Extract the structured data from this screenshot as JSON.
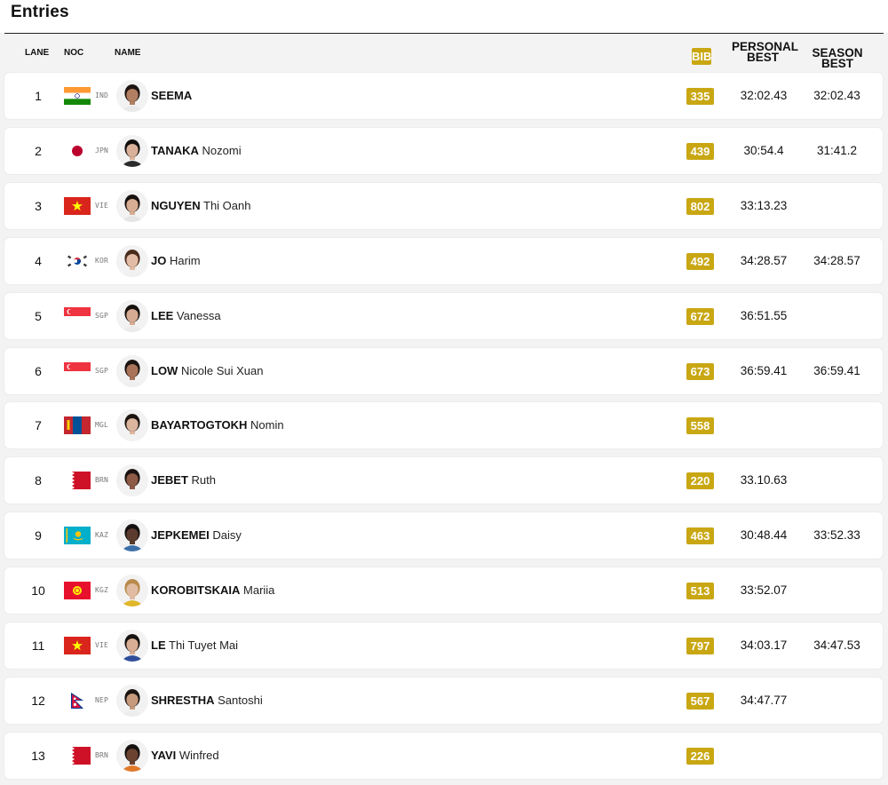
{
  "page": {
    "title": "Entries"
  },
  "columns": {
    "lane": "LANE",
    "noc": "NOC",
    "name": "NAME",
    "bib": "BIB",
    "personal_best": "PERSONAL BEST",
    "season_best": "SEASON BEST"
  },
  "theme": {
    "bib_color": "#c9a713"
  },
  "entries": [
    {
      "lane": "1",
      "noc": "IND",
      "flag": "ind-flag-icon",
      "last_name": "SEEMA",
      "first_name": "",
      "bib": "335",
      "pb": "32:02.43",
      "sb": "32:02.43",
      "skin": "#b27f62",
      "hair": "#1d1410",
      "shirt": "#e9e9e9"
    },
    {
      "lane": "2",
      "noc": "JPN",
      "flag": "jpn-flag-icon",
      "last_name": "TANAKA",
      "first_name": "Nozomi",
      "bib": "439",
      "pb": "30:54.4",
      "sb": "31:41.2",
      "skin": "#d9b19a",
      "hair": "#120e0c",
      "shirt": "#2b2b2b"
    },
    {
      "lane": "3",
      "noc": "VIE",
      "flag": "vie-flag-icon",
      "last_name": "NGUYEN",
      "first_name": "Thi Oanh",
      "bib": "802",
      "pb": "33:13.23",
      "sb": "",
      "skin": "#d7ad93",
      "hair": "#17110e",
      "shirt": "#e5e5e5"
    },
    {
      "lane": "4",
      "noc": "KOR",
      "flag": "kor-flag-icon",
      "last_name": "JO",
      "first_name": "Harim",
      "bib": "492",
      "pb": "34:28.57",
      "sb": "34:28.57",
      "skin": "#e2bca6",
      "hair": "#4a2b1c",
      "shirt": "#f0f0f0"
    },
    {
      "lane": "5",
      "noc": "SGP",
      "flag": "sgp-flag-icon",
      "last_name": "LEE",
      "first_name": "Vanessa",
      "bib": "672",
      "pb": "36:51.55",
      "sb": "",
      "skin": "#d5ab93",
      "hair": "#15100d",
      "shirt": "#ebebeb"
    },
    {
      "lane": "6",
      "noc": "SGP",
      "flag": "sgp-flag-icon",
      "last_name": "LOW",
      "first_name": "Nicole Sui Xuan",
      "bib": "673",
      "pb": "36:59.41",
      "sb": "36:59.41",
      "skin": "#a9735a",
      "hair": "#1a1310",
      "shirt": "#efefef"
    },
    {
      "lane": "7",
      "noc": "MGL",
      "flag": "mgl-flag-icon",
      "last_name": "BAYARTOGTOKH",
      "first_name": "Nomin",
      "bib": "558",
      "pb": "",
      "sb": "",
      "skin": "#dbb59e",
      "hair": "#1b1410",
      "shirt": "#f2f2f2"
    },
    {
      "lane": "8",
      "noc": "BRN",
      "flag": "brn-flag-icon",
      "last_name": "JEBET",
      "first_name": "Ruth",
      "bib": "220",
      "pb": "33.10.63",
      "sb": "",
      "skin": "#8d5a45",
      "hair": "#1a1210",
      "shirt": "#f1f1f1"
    },
    {
      "lane": "9",
      "noc": "KAZ",
      "flag": "kaz-flag-icon",
      "last_name": "JEPKEMEI",
      "first_name": "Daisy",
      "bib": "463",
      "pb": "30:48.44",
      "sb": "33:52.33",
      "skin": "#5a3b2d",
      "hair": "#141010",
      "shirt": "#3d6fa8"
    },
    {
      "lane": "10",
      "noc": "KGZ",
      "flag": "kgz-flag-icon",
      "last_name": "KOROBITSKAIA",
      "first_name": "Mariia",
      "bib": "513",
      "pb": "33:52.07",
      "sb": "",
      "skin": "#e1bca3",
      "hair": "#b88a4c",
      "shirt": "#e0b62a"
    },
    {
      "lane": "11",
      "noc": "VIE",
      "flag": "vie-flag-icon",
      "last_name": "LE",
      "first_name": "Thi Tuyet Mai",
      "bib": "797",
      "pb": "34:03.17",
      "sb": "34:47.53",
      "skin": "#d8ae95",
      "hair": "#16110e",
      "shirt": "#2f4e9a"
    },
    {
      "lane": "12",
      "noc": "NEP",
      "flag": "nep-flag-icon",
      "last_name": "SHRESTHA",
      "first_name": "Santoshi",
      "bib": "567",
      "pb": "34:47.77",
      "sb": "",
      "skin": "#c69a7d",
      "hair": "#1a1310",
      "shirt": "#ededed"
    },
    {
      "lane": "13",
      "noc": "BRN",
      "flag": "brn-flag-icon",
      "last_name": "YAVI",
      "first_name": "Winfred",
      "bib": "226",
      "pb": "",
      "sb": "",
      "skin": "#6b4230",
      "hair": "#141010",
      "shirt": "#e07a2a"
    }
  ]
}
